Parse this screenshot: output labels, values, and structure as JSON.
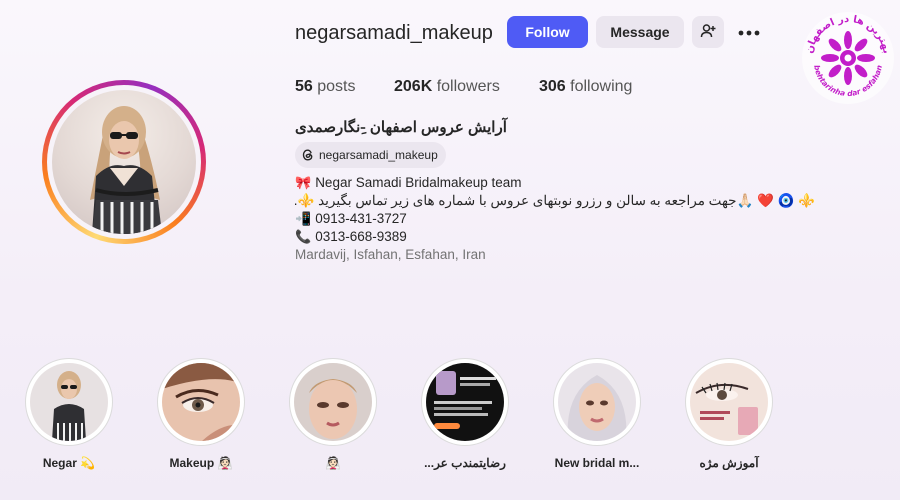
{
  "profile": {
    "username": "negarsamadi_makeup",
    "follow_label": "Follow",
    "message_label": "Message",
    "add_user_icon": "person-add-icon",
    "more_icon": "more-options-icon"
  },
  "stats": {
    "posts_count": "56",
    "posts_label": "posts",
    "followers_count": "206K",
    "followers_label": "followers",
    "following_count": "306",
    "following_label": "following"
  },
  "bio": {
    "full_name": "آرایش عروس اصفهان -ِنگارصمدی",
    "threads_handle": "negarsamadi_makeup",
    "line1": "Negar Samadi Bridalmakeup team",
    "line1_emoji": "🎀",
    "line2": "⚜️ 🧿 ❤️ 🙏🏻جهت مراجعه به سالن و رزرو نوبتهای عروس با شماره های زیر تماس بگیرید ⚜️.",
    "line3": "0913-431-3727",
    "line3_emoji": "📲",
    "line4": "0313-668-9389",
    "line4_emoji": "📞",
    "location": "Mardavij, Isfahan, Esfahan, Iran"
  },
  "watermark": {
    "text_top": "بهترین ها در اصفهان",
    "text_bottom": "behtarinha dar esfahan",
    "color": "#c21ec9"
  },
  "highlights": [
    {
      "label": "Negar 💫"
    },
    {
      "label": "Makeup 👰🏻"
    },
    {
      "label": "👰🏻"
    },
    {
      "label": "رضایتمندب عر..."
    },
    {
      "label": "New bridal m..."
    },
    {
      "label": "آموزش مژه"
    }
  ],
  "colors": {
    "accent": "#4f5bf5",
    "secondary_button": "#ebe6ef",
    "text": "#262626",
    "muted": "#737373"
  }
}
